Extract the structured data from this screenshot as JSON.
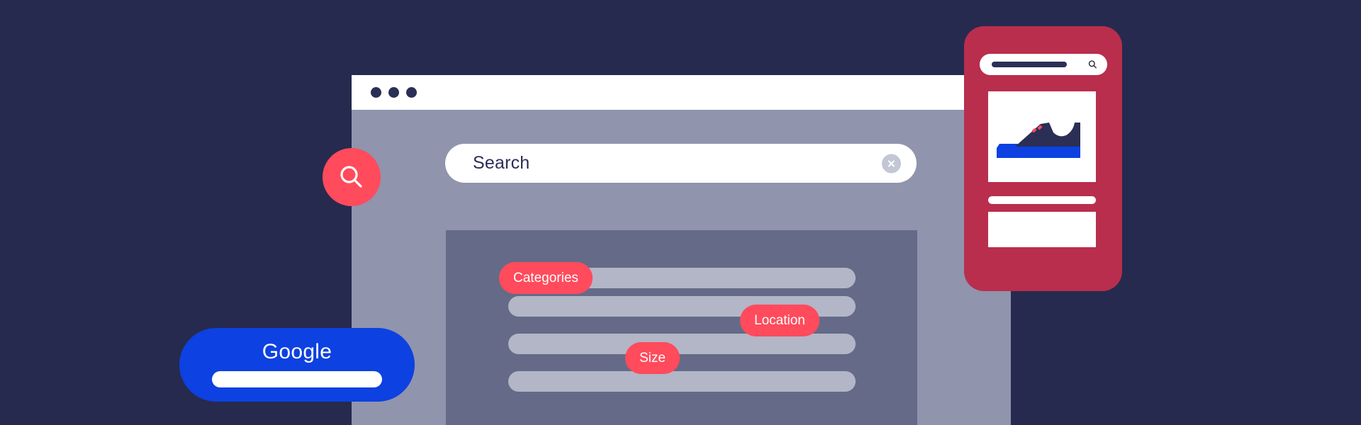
{
  "page": {
    "background_color": "#262a4f",
    "title": "Search experience illustration"
  },
  "browser": {
    "titlebar": {
      "dots": [
        "window-dot-1",
        "window-dot-2",
        "window-dot-3"
      ],
      "dot_color": "#2b2f55",
      "background_color": "#ffffff"
    },
    "viewport_color": "#9094ad",
    "search": {
      "label": "Search",
      "placeholder": "Search",
      "value": "",
      "clear_icon": "close-x-icon",
      "background_color": "#ffffff",
      "text_color": "#2b2f55",
      "clear_button_color": "#c3c6d4"
    },
    "filter_panel": {
      "background_color": "#656a88",
      "row_color": "#b3b6c6",
      "chip_color": "#ff4b5c",
      "chip_text_color": "#ffffff",
      "rows": [
        {
          "id": "row-1",
          "chip": "Categories"
        },
        {
          "id": "row-2",
          "chip": "Location"
        },
        {
          "id": "row-3",
          "chip": "Size"
        },
        {
          "id": "row-4",
          "chip": ""
        }
      ],
      "chips": [
        {
          "label": "Categories"
        },
        {
          "label": "Location"
        },
        {
          "label": "Size"
        }
      ]
    }
  },
  "magnifier_badge": {
    "icon": "search-magnifier-icon",
    "background_color": "#ff4b5c",
    "icon_color": "#ffffff"
  },
  "google_pill": {
    "wordmark": "Google",
    "background_color": "#0d41e1",
    "text_color": "#ffffff",
    "input_value": "",
    "input_color": "#ffffff"
  },
  "phone": {
    "frame_color": "#b92e4c",
    "search": {
      "placeholder_value": "",
      "icon": "search-magnifier-icon",
      "background_color": "#ffffff",
      "placeholder_bar_color": "#2b2f55"
    },
    "hero_card": {
      "background_color": "#ffffff",
      "image": "sneaker-shoe-illustration",
      "shoe_colors": {
        "upper": "#2b2f55",
        "sole": "#0d41e1",
        "accent": "#ff4b5c"
      }
    },
    "divider_bar": {
      "color": "#ffffff"
    },
    "bottom_card": {
      "color": "#ffffff"
    }
  }
}
